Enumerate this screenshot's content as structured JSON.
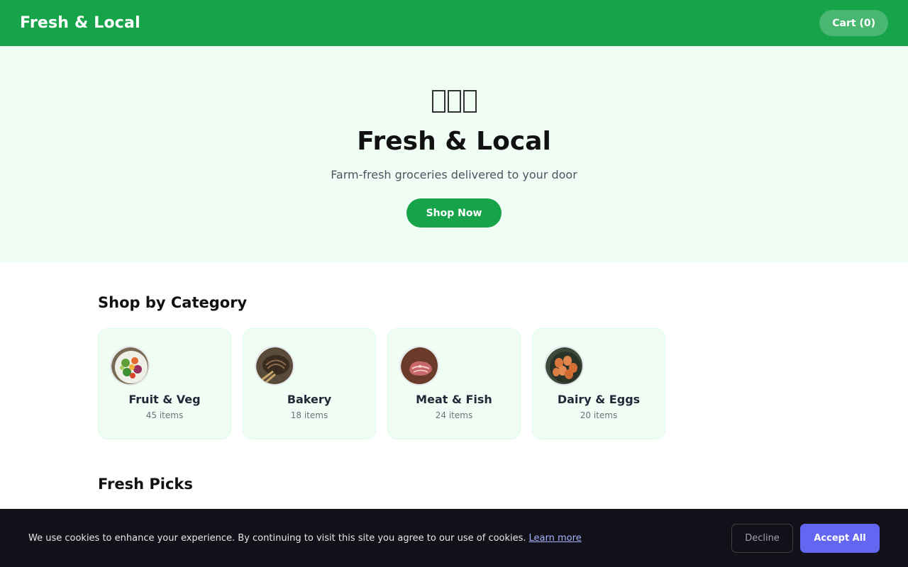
{
  "header": {
    "brand": "Fresh & Local",
    "cart_label": "Cart (0)"
  },
  "hero": {
    "emoji": "🥬🍎🥕",
    "title": "Fresh & Local",
    "subtitle": "Farm-fresh groceries delivered to your door",
    "cta_label": "Shop Now"
  },
  "categories": {
    "heading": "Shop by Category",
    "items": [
      {
        "name": "Fruit & Veg",
        "count": "45 items",
        "image": "salad-bowl"
      },
      {
        "name": "Bakery",
        "count": "18 items",
        "image": "bread-loaf"
      },
      {
        "name": "Meat & Fish",
        "count": "24 items",
        "image": "raw-steak"
      },
      {
        "name": "Dairy & Eggs",
        "count": "20 items",
        "image": "egg-bowl"
      }
    ]
  },
  "picks": {
    "heading": "Fresh Picks"
  },
  "cookie_banner": {
    "message": "We use cookies to enhance your experience. By continuing to visit this site you agree to our use of cookies.",
    "learn_more": "Learn more",
    "decline_label": "Decline",
    "accept_label": "Accept All"
  },
  "colors": {
    "brand_green": "#16a34a",
    "hero_bg": "#f0fdf4",
    "accept_purple": "#6366f1",
    "banner_bg": "#12111a"
  }
}
